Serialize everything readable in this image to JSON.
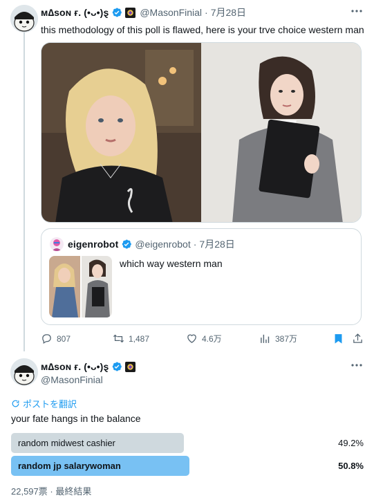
{
  "main_tweet": {
    "display_name": "ᴍ∆sᴏɴ ғ. (•ᴗ•)ȿ",
    "handle": "@MasonFinial",
    "date": "7月28日",
    "text": "this methodology of this poll is flawed, here is your trve choice western man",
    "media": [
      {
        "icon": "photo-blonde-woman-black-sweater"
      },
      {
        "icon": "photo-woman-gray-suit-black-folder"
      }
    ],
    "quote": {
      "display_name": "eigenrobot",
      "handle": "@eigenrobot",
      "date": "7月28日",
      "text": "which way western man",
      "thumbnail_icon": "poll-thumbnail-two-photos"
    },
    "stats": {
      "replies": "807",
      "reposts": "1,487",
      "likes": "4.6万",
      "views": "387万"
    }
  },
  "reply_tweet": {
    "display_name": "ᴍ∆sᴏɴ ғ. (•ᴗ•)ȿ",
    "handle": "@MasonFinial",
    "translate_label": "ポストを翻訳",
    "text": "your fate hangs in the balance",
    "poll": {
      "options": [
        {
          "label": "random midwest cashier",
          "percent_text": "49.2%",
          "percent": 49.2,
          "winner": false
        },
        {
          "label": "random jp salarywoman",
          "percent_text": "50.8%",
          "percent": 50.8,
          "winner": true
        }
      ],
      "meta": "22,597票 · 最終結果"
    }
  },
  "colors": {
    "accent": "#1d9bf0",
    "poll_winner": "#78c1f3",
    "poll_other": "#cfd9de",
    "muted": "#536471"
  }
}
